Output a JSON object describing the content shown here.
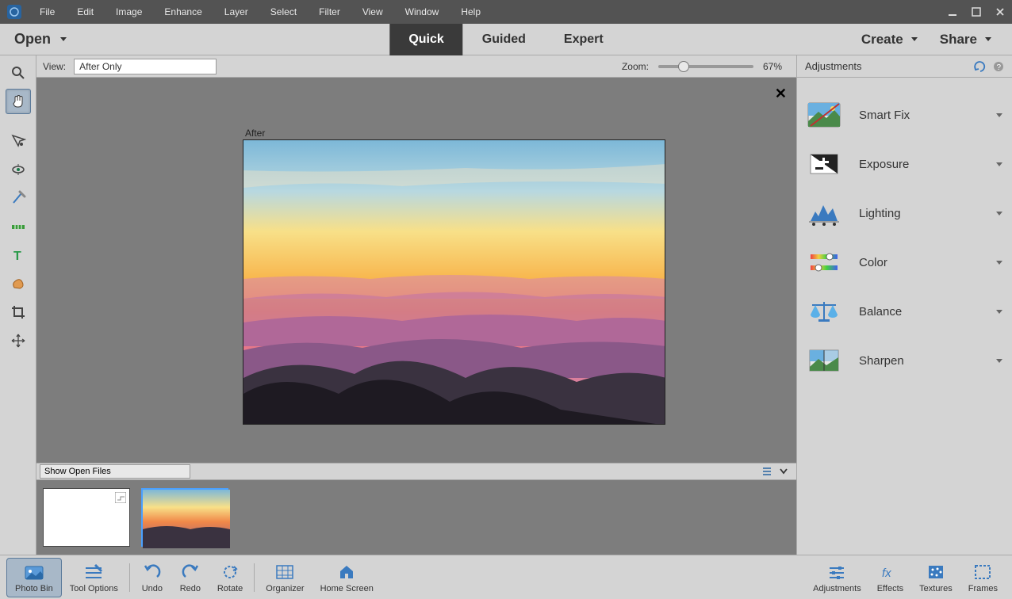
{
  "menu": {
    "items": [
      "File",
      "Edit",
      "Image",
      "Enhance",
      "Layer",
      "Select",
      "Filter",
      "View",
      "Window",
      "Help"
    ]
  },
  "mode": {
    "open": "Open",
    "tabs": [
      "Quick",
      "Guided",
      "Expert"
    ],
    "active": 0,
    "create": "Create",
    "share": "Share"
  },
  "view": {
    "label": "View:",
    "selected": "After Only",
    "zoomLabel": "Zoom:",
    "zoomValue": "67%"
  },
  "canvas": {
    "afterLabel": "After"
  },
  "bin": {
    "selected": "Show Open Files"
  },
  "adjust": {
    "title": "Adjustments",
    "items": [
      {
        "label": "Smart Fix"
      },
      {
        "label": "Exposure"
      },
      {
        "label": "Lighting"
      },
      {
        "label": "Color"
      },
      {
        "label": "Balance"
      },
      {
        "label": "Sharpen"
      }
    ]
  },
  "bottom": {
    "left": [
      {
        "label": "Photo Bin"
      },
      {
        "label": "Tool Options"
      },
      {
        "label": "Undo"
      },
      {
        "label": "Redo"
      },
      {
        "label": "Rotate"
      },
      {
        "label": "Organizer"
      },
      {
        "label": "Home Screen"
      }
    ],
    "right": [
      {
        "label": "Adjustments"
      },
      {
        "label": "Effects"
      },
      {
        "label": "Textures"
      },
      {
        "label": "Frames"
      }
    ]
  }
}
